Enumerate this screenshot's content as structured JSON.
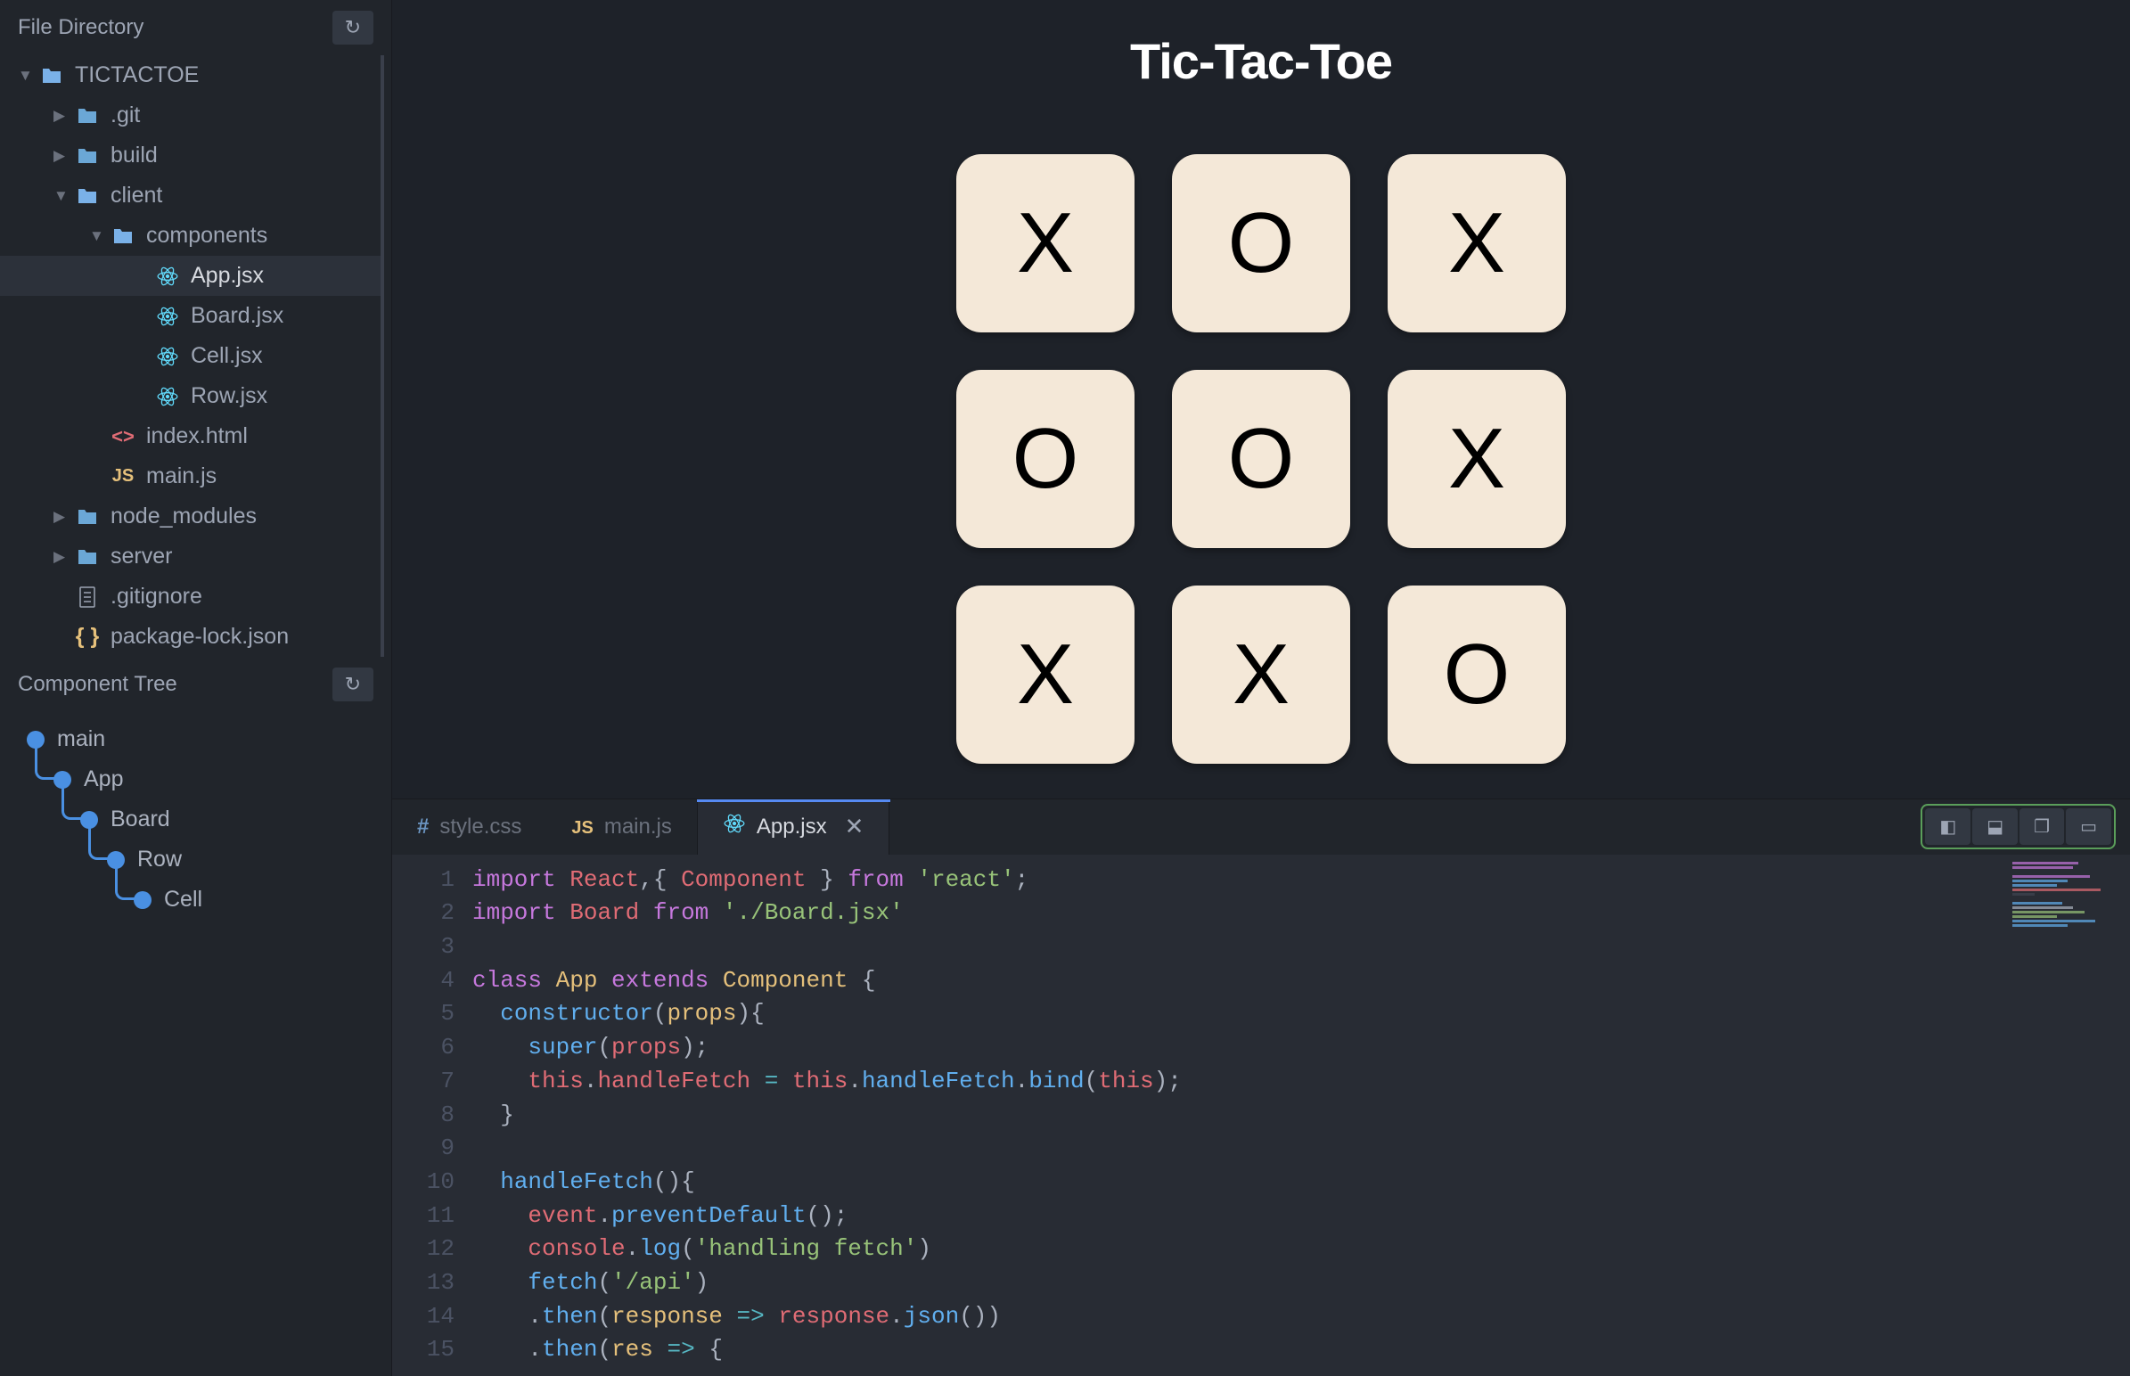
{
  "sidebar": {
    "file_directory_label": "File Directory",
    "component_tree_label": "Component Tree",
    "tree": [
      {
        "label": "TICTACTOE",
        "icon": "folder-open",
        "indent": 0,
        "arrow": "expanded"
      },
      {
        "label": ".git",
        "icon": "folder",
        "indent": 1,
        "arrow": "collapsed"
      },
      {
        "label": "build",
        "icon": "folder",
        "indent": 1,
        "arrow": "collapsed"
      },
      {
        "label": "client",
        "icon": "folder-open",
        "indent": 1,
        "arrow": "expanded"
      },
      {
        "label": "components",
        "icon": "folder-open",
        "indent": 2,
        "arrow": "expanded"
      },
      {
        "label": "App.jsx",
        "icon": "react",
        "indent": 3,
        "arrow": "none",
        "active": true
      },
      {
        "label": "Board.jsx",
        "icon": "react",
        "indent": 3,
        "arrow": "none"
      },
      {
        "label": "Cell.jsx",
        "icon": "react",
        "indent": 3,
        "arrow": "none"
      },
      {
        "label": "Row.jsx",
        "icon": "react",
        "indent": 3,
        "arrow": "none"
      },
      {
        "label": "index.html",
        "icon": "html",
        "indent": 2,
        "arrow": "none"
      },
      {
        "label": "main.js",
        "icon": "js",
        "indent": 2,
        "arrow": "none"
      },
      {
        "label": "node_modules",
        "icon": "folder",
        "indent": 1,
        "arrow": "collapsed"
      },
      {
        "label": "server",
        "icon": "folder",
        "indent": 1,
        "arrow": "collapsed"
      },
      {
        "label": ".gitignore",
        "icon": "file",
        "indent": 1,
        "arrow": "none"
      },
      {
        "label": "package-lock.json",
        "icon": "json",
        "indent": 1,
        "arrow": "none"
      }
    ],
    "components": [
      {
        "label": "main",
        "indent": 0
      },
      {
        "label": "App",
        "indent": 1
      },
      {
        "label": "Board",
        "indent": 2
      },
      {
        "label": "Row",
        "indent": 3
      },
      {
        "label": "Cell",
        "indent": 4
      }
    ]
  },
  "preview": {
    "title": "Tic-Tac-Toe",
    "cells": [
      "X",
      "O",
      "X",
      "O",
      "O",
      "X",
      "X",
      "X",
      "O"
    ]
  },
  "editor": {
    "tabs": [
      {
        "label": "style.css",
        "icon": "css",
        "active": false
      },
      {
        "label": "main.js",
        "icon": "js",
        "active": false
      },
      {
        "label": "App.jsx",
        "icon": "react",
        "active": true,
        "closable": true
      }
    ],
    "code": {
      "lines": [
        {
          "n": 1,
          "html": "<span class='tok-kw'>import</span> <span class='tok-var'>React</span><span class='tok-pn'>,{ </span><span class='tok-var'>Component</span><span class='tok-pn'> }</span> <span class='tok-kw'>from</span> <span class='tok-str'>'react'</span><span class='tok-pn'>;</span>"
        },
        {
          "n": 2,
          "html": "<span class='tok-kw'>import</span> <span class='tok-var'>Board</span> <span class='tok-kw'>from</span> <span class='tok-str'>'./Board.jsx'</span>"
        },
        {
          "n": 3,
          "html": ""
        },
        {
          "n": 4,
          "html": "<span class='tok-kw'>class</span> <span class='tok-cls'>App</span> <span class='tok-kw'>extends</span> <span class='tok-cls'>Component</span> <span class='tok-pn'>{</span>"
        },
        {
          "n": 5,
          "html": "  <span class='tok-fn'>constructor</span><span class='tok-pn'>(</span><span class='tok-param'>props</span><span class='tok-pn'>){</span>"
        },
        {
          "n": 6,
          "html": "    <span class='tok-fn'>super</span><span class='tok-pn'>(</span><span class='tok-var'>props</span><span class='tok-pn'>);</span>"
        },
        {
          "n": 7,
          "html": "    <span class='tok-this'>this</span><span class='tok-pn'>.</span><span class='tok-prop'>handleFetch</span> <span class='tok-op'>=</span> <span class='tok-this'>this</span><span class='tok-pn'>.</span><span class='tok-fn'>handleFetch</span><span class='tok-pn'>.</span><span class='tok-fn'>bind</span><span class='tok-pn'>(</span><span class='tok-this'>this</span><span class='tok-pn'>);</span>"
        },
        {
          "n": 8,
          "html": "  <span class='tok-pn'>}</span>"
        },
        {
          "n": 9,
          "html": ""
        },
        {
          "n": 10,
          "html": "  <span class='tok-fn'>handleFetch</span><span class='tok-pn'>(){</span>"
        },
        {
          "n": 11,
          "html": "    <span class='tok-var'>event</span><span class='tok-pn'>.</span><span class='tok-fn'>preventDefault</span><span class='tok-pn'>();</span>"
        },
        {
          "n": 12,
          "html": "    <span class='tok-var'>console</span><span class='tok-pn'>.</span><span class='tok-fn'>log</span><span class='tok-pn'>(</span><span class='tok-str'>'handling fetch'</span><span class='tok-pn'>)</span>"
        },
        {
          "n": 13,
          "html": "    <span class='tok-fn'>fetch</span><span class='tok-pn'>(</span><span class='tok-str'>'/api'</span><span class='tok-pn'>)</span>"
        },
        {
          "n": 14,
          "html": "    <span class='tok-pn'>.</span><span class='tok-fn'>then</span><span class='tok-pn'>(</span><span class='tok-param'>response</span> <span class='tok-op'>=&gt;</span> <span class='tok-var'>response</span><span class='tok-pn'>.</span><span class='tok-fn'>json</span><span class='tok-pn'>())</span>"
        },
        {
          "n": 15,
          "html": "    <span class='tok-pn'>.</span><span class='tok-fn'>then</span><span class='tok-pn'>(</span><span class='tok-param'>res</span> <span class='tok-op'>=&gt;</span> <span class='tok-pn'>{</span>"
        }
      ]
    }
  }
}
